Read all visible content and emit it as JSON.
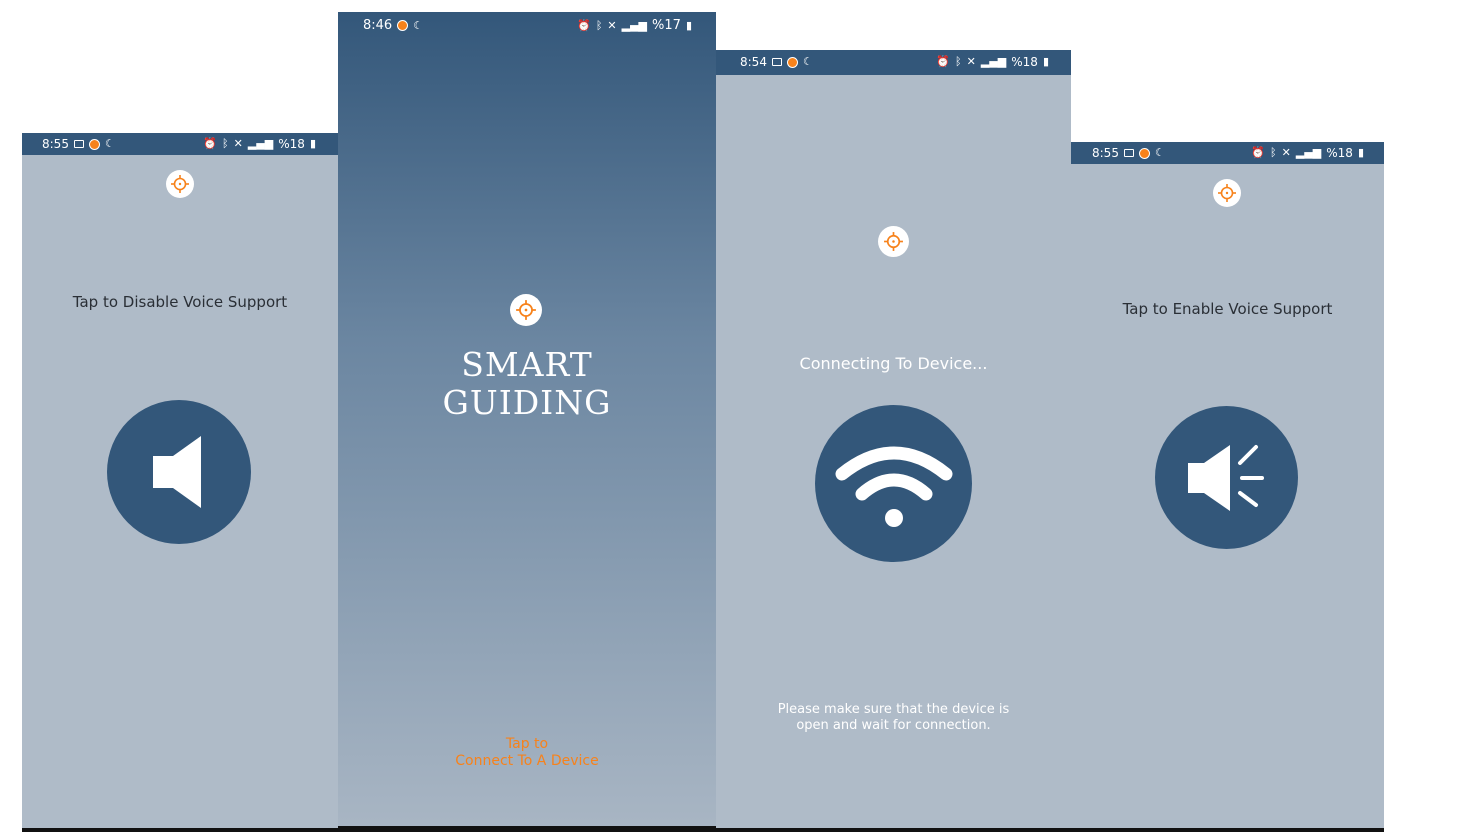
{
  "screens": [
    {
      "status": {
        "time": "8:55",
        "battery": "%18"
      },
      "prompt": "Tap to Disable Voice Support"
    },
    {
      "status": {
        "time": "8:46",
        "battery": "%17"
      },
      "title_line1": "SMART",
      "title_line2": "GUIDING",
      "tap_line1": "Tap to",
      "tap_line2": "Connect To A Device"
    },
    {
      "status": {
        "time": "8:54",
        "battery": "%18"
      },
      "heading": "Connecting To Device...",
      "note_line1": "Please make sure that the device is",
      "note_line2": "open and wait for connection."
    },
    {
      "status": {
        "time": "8:55",
        "battery": "%18"
      },
      "prompt": "Tap to Enable Voice Support"
    }
  ],
  "colors": {
    "primary": "#33577a",
    "screen_bg": "#afbbc8",
    "accent": "#f7821b"
  },
  "icons": [
    "crosshair-logo-icon",
    "speaker-muted-icon",
    "wifi-icon",
    "speaker-on-icon"
  ]
}
